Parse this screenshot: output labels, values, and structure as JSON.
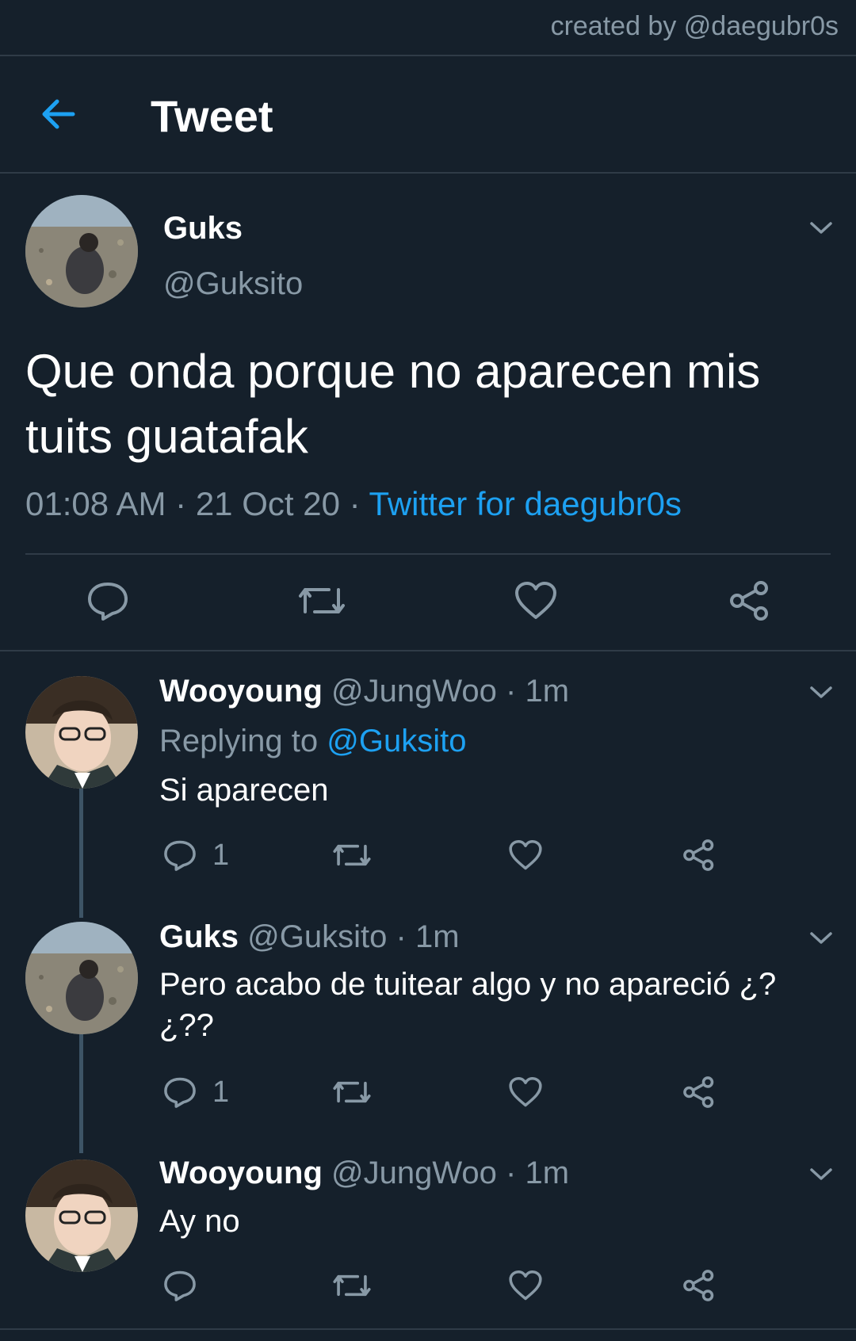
{
  "credit": "created by @daegubr0s",
  "header": {
    "title": "Tweet",
    "back_icon": "back-arrow-icon"
  },
  "colors": {
    "background": "#15202b",
    "accent": "#1da1f2",
    "muted": "#8899a6",
    "divider": "#2f3b47"
  },
  "main_tweet": {
    "name": "Guks",
    "handle": "@Guksito",
    "text": "Que onda porque no aparecen mis tuits guatafak",
    "time": "01:08 AM",
    "date": "21 Oct 20",
    "via": "Twitter for daegubr0s",
    "sep": "·"
  },
  "replies": [
    {
      "name": "Wooyoung",
      "handle": "@JungWoo",
      "time": "1m",
      "replying_label": "Replying to",
      "replying_to": "@Guksito",
      "text": "Si aparecen",
      "reply_count": "1"
    },
    {
      "name": "Guks",
      "handle": "@Guksito",
      "time": "1m",
      "text": "Pero acabo de tuitear algo y no apareció ¿?¿??",
      "reply_count": "1"
    },
    {
      "name": "Wooyoung",
      "handle": "@JungWoo",
      "time": "1m",
      "text": "Ay no",
      "reply_count": ""
    }
  ]
}
